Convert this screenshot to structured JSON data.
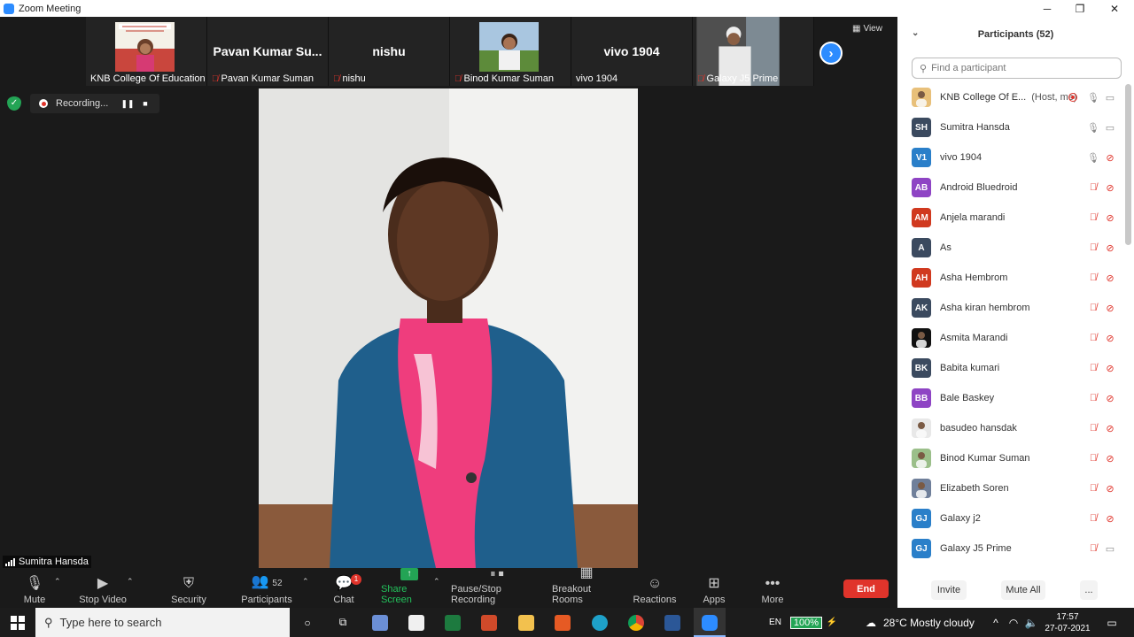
{
  "window": {
    "title": "Zoom Meeting",
    "minimize": "─",
    "maximize": "❐",
    "close": "✕"
  },
  "thumbnails": [
    {
      "big_name": "",
      "name": "KNB College Of Education",
      "has_photo": true,
      "muted": false
    },
    {
      "big_name": "Pavan Kumar Su...",
      "name": "Pavan Kumar Suman",
      "has_photo": false,
      "muted": true
    },
    {
      "big_name": "nishu",
      "name": "nishu",
      "has_photo": false,
      "muted": true
    },
    {
      "big_name": "",
      "name": "Binod Kumar Suman",
      "has_photo": true,
      "muted": true
    },
    {
      "big_name": "vivo 1904",
      "name": "vivo 1904",
      "has_photo": false,
      "muted": false
    },
    {
      "big_name": "",
      "name": "Galaxy J5 Prime",
      "has_photo": true,
      "muted": true
    }
  ],
  "view_label": "View",
  "recording": {
    "label": "Recording..."
  },
  "active_speaker": {
    "name": "Sumitra Hansda"
  },
  "toolbar": {
    "mute": "Mute",
    "stop_video": "Stop Video",
    "security": "Security",
    "participants": "Participants",
    "participants_count": "52",
    "chat": "Chat",
    "chat_badge": "1",
    "share_screen": "Share Screen",
    "pause_stop_recording": "Pause/Stop Recording",
    "breakout_rooms": "Breakout Rooms",
    "reactions": "Reactions",
    "apps": "Apps",
    "more": "More",
    "end": "End"
  },
  "panel": {
    "title": "Participants (52)",
    "search_placeholder": "Find a participant",
    "participants": [
      {
        "initials": "",
        "name": "KNB College Of E...",
        "role": "(Host, me)",
        "color": "#e8c07a",
        "mic": "on",
        "cam": "on",
        "recording": true
      },
      {
        "initials": "SH",
        "name": "Sumitra Hansda",
        "role": "",
        "color": "#3b4a5f",
        "mic": "on",
        "cam": "on"
      },
      {
        "initials": "V1",
        "name": "vivo 1904",
        "role": "",
        "color": "#2a7fc9",
        "mic": "on",
        "cam": "off"
      },
      {
        "initials": "AB",
        "name": "Android Bluedroid",
        "role": "",
        "color": "#8e44c4",
        "mic": "off",
        "cam": "off"
      },
      {
        "initials": "AM",
        "name": "Anjela marandi",
        "role": "",
        "color": "#d0391f",
        "mic": "off",
        "cam": "off"
      },
      {
        "initials": "A",
        "name": "As",
        "role": "",
        "color": "#3b4a5f",
        "mic": "off",
        "cam": "off"
      },
      {
        "initials": "AH",
        "name": "Asha Hembrom",
        "role": "",
        "color": "#d0391f",
        "mic": "off",
        "cam": "off"
      },
      {
        "initials": "AK",
        "name": "Asha kiran hembrom",
        "role": "",
        "color": "#3b4a5f",
        "mic": "off",
        "cam": "off"
      },
      {
        "initials": "",
        "name": "Asmita Marandi",
        "role": "",
        "color": "#111111",
        "mic": "off",
        "cam": "off"
      },
      {
        "initials": "BK",
        "name": "Babita kumari",
        "role": "",
        "color": "#3b4a5f",
        "mic": "off",
        "cam": "off"
      },
      {
        "initials": "BB",
        "name": "Bale Baskey",
        "role": "",
        "color": "#8e44c4",
        "mic": "off",
        "cam": "off"
      },
      {
        "initials": "",
        "name": "basudeo hansdak",
        "role": "",
        "color": "#e8e8e8",
        "mic": "off",
        "cam": "off"
      },
      {
        "initials": "",
        "name": "Binod Kumar Suman",
        "role": "",
        "color": "#9bbf8a",
        "mic": "off",
        "cam": "off"
      },
      {
        "initials": "",
        "name": "Elizabeth Soren",
        "role": "",
        "color": "#6f7f9a",
        "mic": "off",
        "cam": "off"
      },
      {
        "initials": "GJ",
        "name": "Galaxy j2",
        "role": "",
        "color": "#2a7fc9",
        "mic": "off",
        "cam": "off"
      },
      {
        "initials": "GJ",
        "name": "Galaxy J5 Prime",
        "role": "",
        "color": "#2a7fc9",
        "mic": "off",
        "cam": "on"
      }
    ],
    "invite": "Invite",
    "mute_all": "Mute All",
    "more": "..."
  },
  "taskbar": {
    "search_placeholder": "Type here to search",
    "language": "EN",
    "battery": "100%",
    "weather": "28°C  Mostly cloudy",
    "time": "17:57",
    "date": "27-07-2021"
  }
}
